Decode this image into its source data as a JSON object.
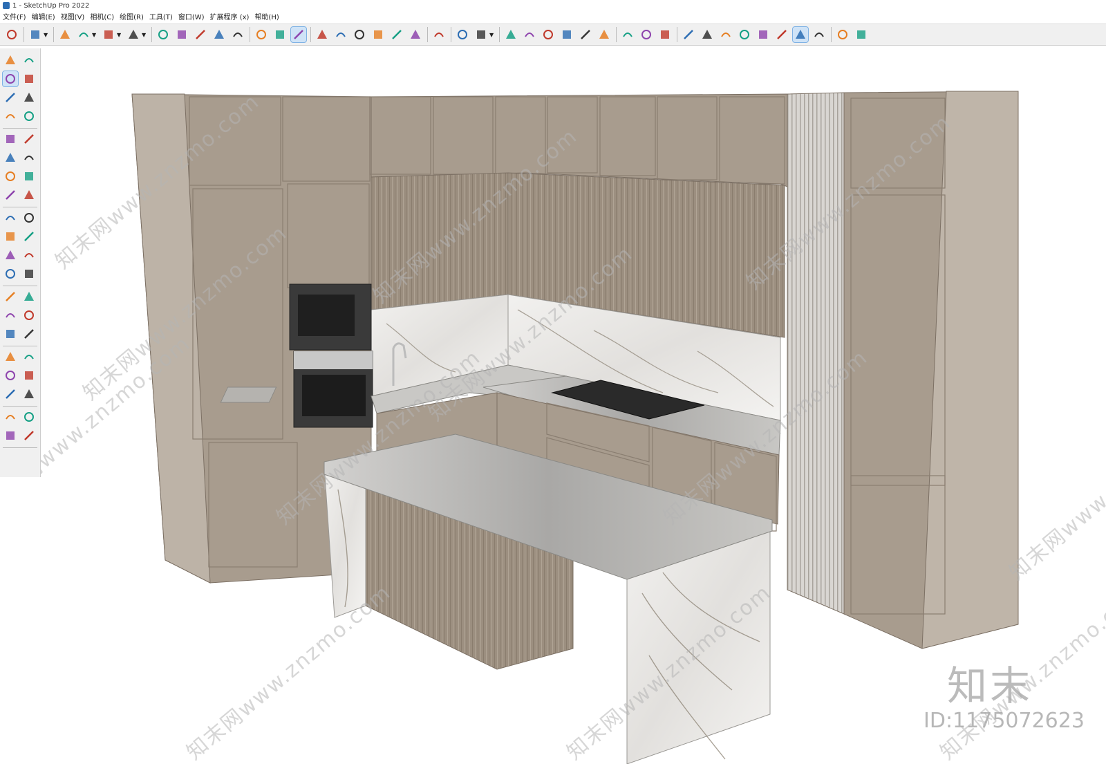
{
  "window": {
    "title": "1 - SketchUp Pro 2022"
  },
  "menu": [
    "文件(F)",
    "编辑(E)",
    "视图(V)",
    "相机(C)",
    "绘图(R)",
    "工具(T)",
    "窗口(W)",
    "扩展程序 (x)",
    "帮助(H)"
  ],
  "toolbar_icons": [
    "zoom-extents",
    "select",
    "dropdown",
    "eraser",
    "pencil",
    "dropdown",
    "arc",
    "dropdown",
    "rectangle",
    "dropdown",
    "push-pull",
    "follow-me",
    "move",
    "rotate",
    "scale",
    "tape-measure",
    "text",
    "paint-bucket",
    "orbit",
    "pan",
    "zoom",
    "zoom-window",
    "component",
    "styles",
    "layers",
    "extension",
    "account",
    "dropdown",
    "warehouse",
    "model-info",
    "house",
    "house-2",
    "house-3",
    "house-4",
    "solid-tools",
    "section",
    "section-fill",
    "add",
    "sandbox",
    "match-photo",
    "checker",
    "cloud",
    "settings",
    "scenes",
    "info",
    "cart",
    "user"
  ],
  "left_tool_icons": [
    "select",
    "orbit",
    "paint-bucket",
    "eraser",
    "component",
    "tape",
    "line",
    "freehand",
    "rectangle",
    "rotated-rect",
    "circle",
    "polygon",
    "arc",
    "pie",
    "arc-3pt",
    "arc-2pt",
    "move",
    "push-pull",
    "rotate",
    "follow-me",
    "scale",
    "offset",
    "tape-measure",
    "text",
    "axes",
    "3d-text",
    "orbit",
    "pan",
    "zoom",
    "zoom-window",
    "zoom-extents",
    "previous",
    "position-camera",
    "look-around",
    "walk",
    "section",
    "component-edit",
    "styles",
    "layers",
    "outliner"
  ],
  "watermarks": [
    "知末网www.znzmo.com",
    "知末网www.znzmo.com",
    "知末网www.znzmo.com",
    "知末网www.znzmo.com",
    "知末网www.znzmo.com",
    "知末网www.znzmo.com",
    "知末网www.znzmo.com",
    "知末网www.znzmo.com",
    "知末网www.znzmo.com",
    "知末网www.znzmo.com",
    "知末网www.znzmo.com",
    "知末网www.znzmo.com"
  ],
  "brand": "知末",
  "image_id": "ID:1175072623",
  "colors": {
    "cabinet": "#a89c8e",
    "cabinet_dark": "#8f8272",
    "marble": "#ecebe9",
    "toolbar_bg": "#f0f0f0"
  }
}
